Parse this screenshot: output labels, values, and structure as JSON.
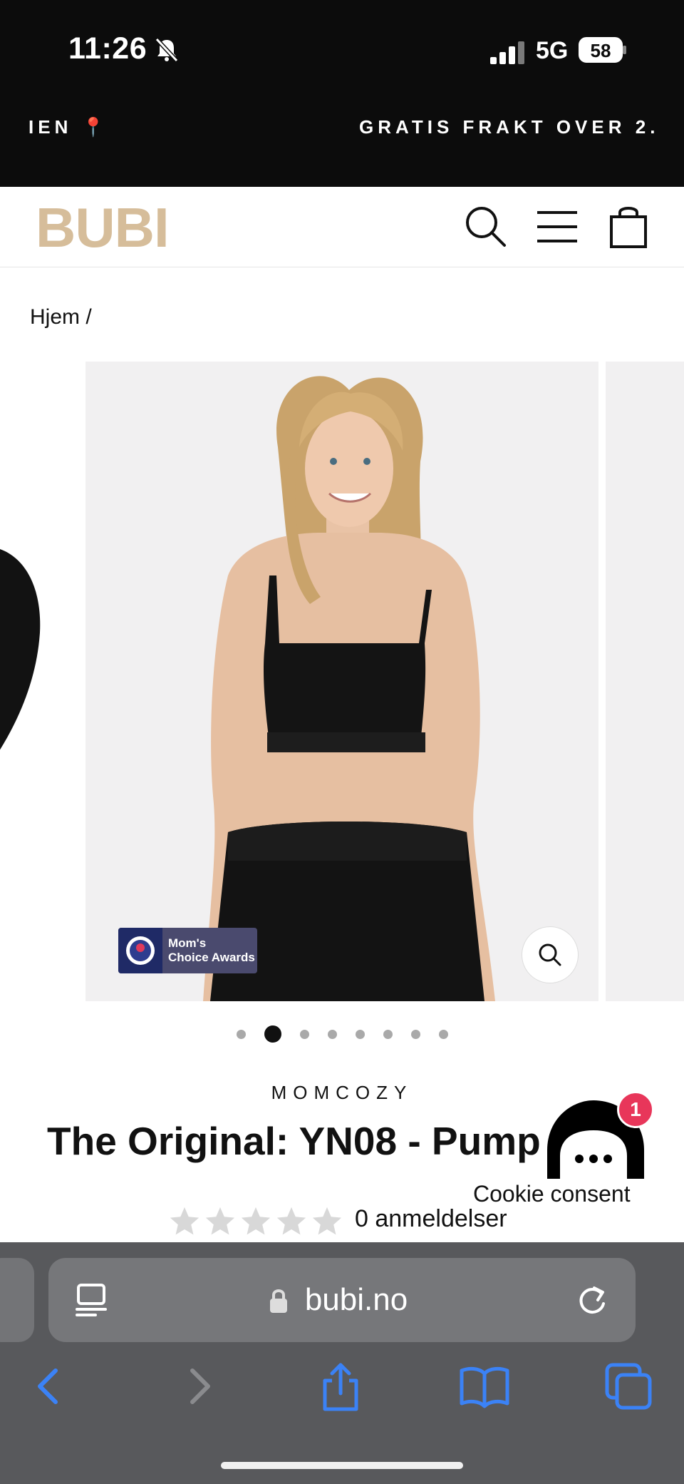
{
  "status_bar": {
    "time": "11:26",
    "network": "5G",
    "battery": "58"
  },
  "announcement": {
    "left_text": "IEN 📍",
    "right_text": "GRATIS FRAKT OVER 2."
  },
  "header": {
    "logo": "BUBI",
    "icons": [
      "search-icon",
      "menu-icon",
      "cart-icon"
    ]
  },
  "breadcrumb": "Hjem /",
  "carousel": {
    "badge": {
      "line1": "Mom's",
      "line2": "Choice Awards"
    },
    "dot_count": 8,
    "active_dot": 1
  },
  "product": {
    "brand": "MOMCOZY",
    "title": "The Original: YN08 - Pump",
    "rating": 0,
    "reviews": "0 anmeldelser"
  },
  "chat_widget": {
    "unread": "1",
    "label": "Cookie consent"
  },
  "browser": {
    "url": "bubi.no"
  },
  "colors": {
    "logo": "#d6bd9a",
    "chat_badge": "#e8365a",
    "safari_blue": "#3b82f6"
  }
}
